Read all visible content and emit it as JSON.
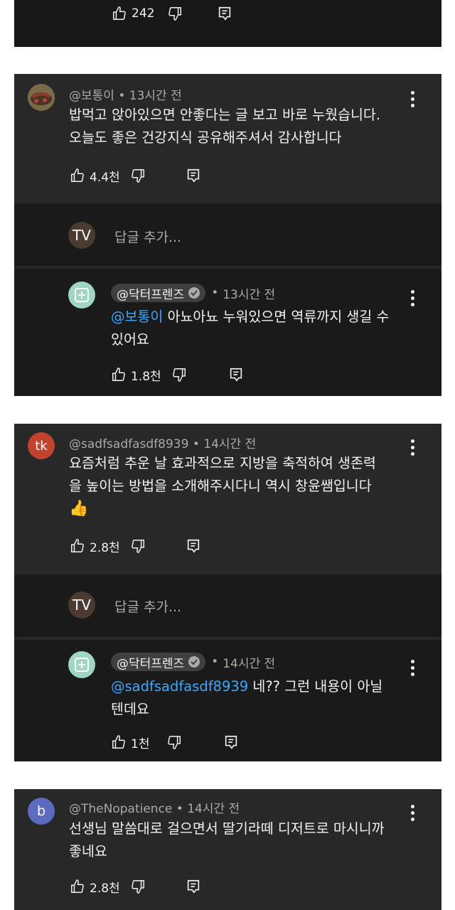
{
  "top_card": {
    "likes": "242"
  },
  "thread1": {
    "comment": {
      "handle": "@보통이",
      "time": "13시간 전",
      "lines": [
        "밥먹고 앉아있으면 안좋다는 글 보고 바로 누웠습니다.",
        "오늘도 좋은 건강지식 공유해주셔서 감사합니다"
      ],
      "likes": "4.4천"
    },
    "reply_box": {
      "avatar_text": "TV",
      "placeholder": "답글 추가..."
    },
    "reply": {
      "handle": "@닥터프렌즈",
      "time": "13시간 전",
      "mention": "@보통이",
      "line1_rest": " 아뇨아뇨 누워있으면 역류까지 생길 수",
      "line2": "있어요",
      "likes": "1.8천"
    }
  },
  "thread2": {
    "comment": {
      "avatar_text": "tk",
      "handle": "@sadfsadfasdf8939",
      "time": "14시간 전",
      "lines": [
        "요즘처럼 추운 날 효과적으로 지방을 축적하여 생존력",
        "을 높이는 방법을 소개해주시다니 역시 창윤쌤입니다"
      ],
      "emoji": "👍",
      "likes": "2.8천"
    },
    "reply_box": {
      "avatar_text": "TV",
      "placeholder": "답글 추가..."
    },
    "reply": {
      "handle": "@닥터프렌즈",
      "time": "14시간 전",
      "mention": "@sadfsadfasdf8939",
      "line1_rest": " 네?? 그런 내용이 아닐",
      "line2": "텐데요",
      "likes": "1천"
    }
  },
  "thread3": {
    "comment": {
      "avatar_text": "b",
      "handle": "@TheNopatience",
      "time": "14시간 전",
      "lines": [
        "선생님 말씀대로 걸으면서 딸기라떼 디저트로 마시니까",
        "좋네요"
      ],
      "likes": "2.8천"
    }
  },
  "meta_separator": "•",
  "colors": {
    "card": "#282828",
    "reply_area": "#1a1a1a",
    "mention": "#3ea6ff",
    "muted": "#aaaaaa"
  }
}
